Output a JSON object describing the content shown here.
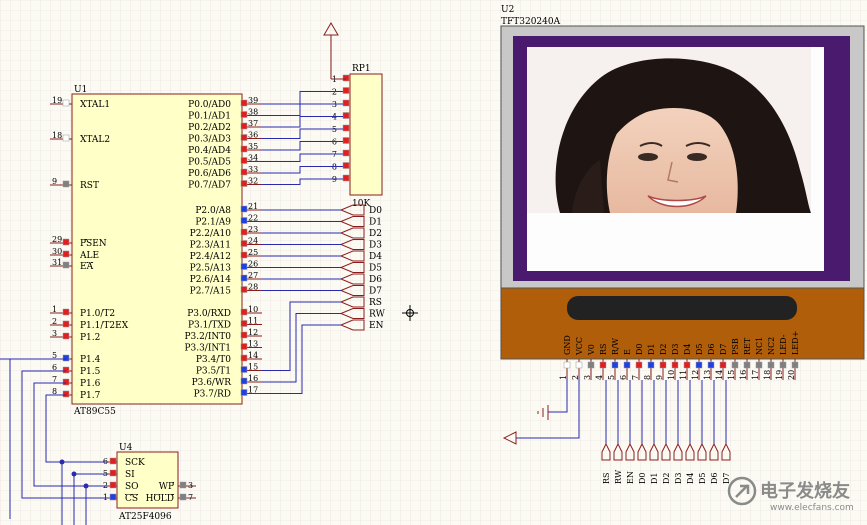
{
  "u1": {
    "designator": "U1",
    "part": "AT89C55",
    "left_pins": [
      {
        "num": "19",
        "name": "XTAL1",
        "color": "#ffffff"
      },
      {
        "num": "18",
        "name": "XTAL2",
        "color": "#ffffff"
      },
      {
        "num": "9",
        "name": "RST",
        "color": "#808080"
      },
      {
        "num": "29",
        "name": "PSEN",
        "color": "#e02020",
        "overline": true
      },
      {
        "num": "30",
        "name": "ALE",
        "color": "#e02020"
      },
      {
        "num": "31",
        "name": "EA",
        "color": "#808080",
        "overline": true
      },
      {
        "num": "1",
        "name": "P1.0/T2",
        "color": "#e02020"
      },
      {
        "num": "2",
        "name": "P1.1/T2EX",
        "color": "#e02020"
      },
      {
        "num": "3",
        "name": "P1.2",
        "color": "#e02020"
      },
      {
        "num": "5",
        "name": "P1.4",
        "color": "#2040e0"
      },
      {
        "num": "6",
        "name": "P1.5",
        "color": "#e02020"
      },
      {
        "num": "7",
        "name": "P1.6",
        "color": "#e02020"
      },
      {
        "num": "8",
        "name": "P1.7",
        "color": "#e02020"
      }
    ],
    "right_pins": [
      {
        "num": "39",
        "name": "P0.0/AD0",
        "color": "#e02020"
      },
      {
        "num": "38",
        "name": "P0.1/AD1",
        "color": "#e02020"
      },
      {
        "num": "37",
        "name": "P0.2/AD2",
        "color": "#e02020"
      },
      {
        "num": "36",
        "name": "P0.3/AD3",
        "color": "#e02020"
      },
      {
        "num": "35",
        "name": "P0.4/AD4",
        "color": "#e02020"
      },
      {
        "num": "34",
        "name": "P0.5/AD5",
        "color": "#e02020"
      },
      {
        "num": "33",
        "name": "P0.6/AD6",
        "color": "#e02020"
      },
      {
        "num": "32",
        "name": "P0.7/AD7",
        "color": "#e02020"
      },
      {
        "num": "21",
        "name": "P2.0/A8",
        "color": "#2040e0"
      },
      {
        "num": "22",
        "name": "P2.1/A9",
        "color": "#2040e0"
      },
      {
        "num": "23",
        "name": "P2.2/A10",
        "color": "#e02020"
      },
      {
        "num": "24",
        "name": "P2.3/A11",
        "color": "#e02020"
      },
      {
        "num": "25",
        "name": "P2.4/A12",
        "color": "#e02020"
      },
      {
        "num": "26",
        "name": "P2.5/A13",
        "color": "#2040e0"
      },
      {
        "num": "27",
        "name": "P2.6/A14",
        "color": "#2040e0"
      },
      {
        "num": "28",
        "name": "P2.7/A15",
        "color": "#e02020"
      },
      {
        "num": "10",
        "name": "P3.0/RXD",
        "color": "#e02020"
      },
      {
        "num": "11",
        "name": "P3.1/TXD",
        "color": "#e02020"
      },
      {
        "num": "12",
        "name": "P3.2/INT0",
        "color": "#e02020"
      },
      {
        "num": "13",
        "name": "P3.3/INT1",
        "color": "#e02020"
      },
      {
        "num": "14",
        "name": "P3.4/T0",
        "color": "#e02020"
      },
      {
        "num": "15",
        "name": "P3.5/T1",
        "color": "#2040e0"
      },
      {
        "num": "16",
        "name": "P3.6/WR",
        "color": "#2040e0"
      },
      {
        "num": "17",
        "name": "P3.7/RD",
        "color": "#2040e0"
      }
    ]
  },
  "rp1": {
    "designator": "RP1",
    "value": "10K",
    "pins": [
      "1",
      "2",
      "3",
      "4",
      "5",
      "6",
      "7",
      "8",
      "9"
    ]
  },
  "port_labels": [
    "D0",
    "D1",
    "D2",
    "D3",
    "D4",
    "D5",
    "D6",
    "D7",
    "RS",
    "RW",
    "EN"
  ],
  "u2": {
    "designator": "U2",
    "part": "TFT320240A",
    "pin_names": [
      "GND",
      "VCC",
      "V0",
      "RS",
      "R/W",
      "E",
      "D0",
      "D1",
      "D2",
      "D3",
      "D4",
      "D5",
      "D6",
      "D7",
      "PSB",
      "RET",
      "NC1",
      "NC2",
      "LED-",
      "LED+"
    ],
    "pin_nums": [
      "1",
      "2",
      "3",
      "4",
      "5",
      "6",
      "7",
      "8",
      "9",
      "10",
      "11",
      "12",
      "13",
      "14",
      "15",
      "16",
      "17",
      "18",
      "19",
      "20"
    ],
    "pin_colors": [
      "#ffffff",
      "#ffffff",
      "#808080",
      "#e02020",
      "#2040e0",
      "#2040e0",
      "#e02020",
      "#2040e0",
      "#e02020",
      "#e02020",
      "#e02020",
      "#2040e0",
      "#2040e0",
      "#e02020",
      "#808080",
      "#808080",
      "#808080",
      "#808080",
      "#808080",
      "#808080"
    ],
    "bottom_labels": [
      "RS",
      "RW",
      "EN",
      "D0",
      "D1",
      "D2",
      "D3",
      "D4",
      "D5",
      "D6",
      "D7"
    ]
  },
  "u4": {
    "designator": "U4",
    "part": "AT25F4096",
    "left_pins": [
      {
        "num": "6",
        "name": "SCK",
        "color": "#e02020"
      },
      {
        "num": "5",
        "name": "SI",
        "color": "#e02020"
      },
      {
        "num": "2",
        "name": "SO",
        "color": "#e02020",
        "overline": false
      },
      {
        "num": "1",
        "name": "CS",
        "color": "#2040e0",
        "overline": true
      }
    ],
    "right_pins": [
      {
        "num": "3",
        "name": "WP",
        "color": "#808080",
        "overline": true
      },
      {
        "num": "7",
        "name": "HOLD",
        "color": "#808080",
        "overline": true
      }
    ]
  },
  "watermark": {
    "title": "电子发烧友",
    "url": "www.elecfans.com"
  },
  "colors": {
    "pin_red": "#e02020",
    "pin_blue": "#2040e0",
    "wire_blue": "#2a2ab0",
    "part_outline": "#8a1e1e",
    "part_fill": "#ffffc8",
    "lcd_bezel": "#4a1a6e",
    "lcd_pcb": "#b05e0a"
  }
}
